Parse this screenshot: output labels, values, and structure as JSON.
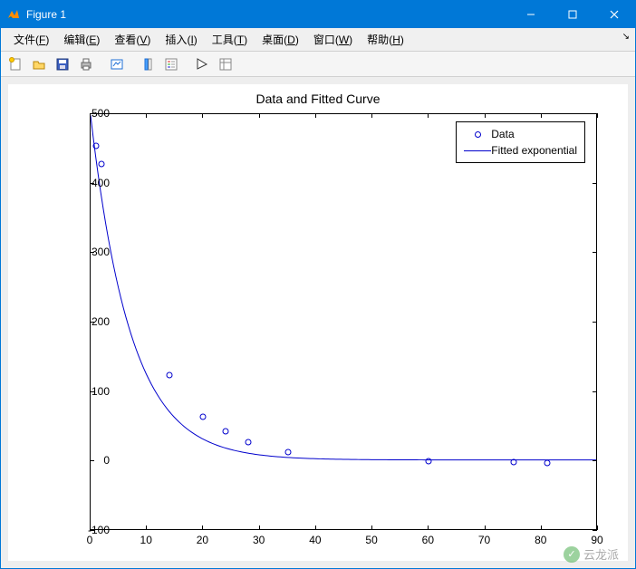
{
  "window": {
    "title": "Figure 1"
  },
  "menus": {
    "file": "文件",
    "file_u": "F",
    "edit": "编辑",
    "edit_u": "E",
    "view": "查看",
    "view_u": "V",
    "insert": "插入",
    "insert_u": "I",
    "tools": "工具",
    "tools_u": "T",
    "desktop": "桌面",
    "desktop_u": "D",
    "window_m": "窗口",
    "window_u": "W",
    "help": "帮助",
    "help_u": "H"
  },
  "legend": {
    "data": "Data",
    "fit": "Fitted exponential"
  },
  "watermark": {
    "text": "云龙派"
  },
  "chart_data": {
    "type": "scatter+line",
    "title": "Data and Fitted Curve",
    "xlabel": "",
    "ylabel": "",
    "xlim": [
      0,
      90
    ],
    "ylim": [
      -100,
      500
    ],
    "xticks": [
      0,
      10,
      20,
      30,
      40,
      50,
      60,
      70,
      80,
      90
    ],
    "yticks": [
      -100,
      0,
      100,
      200,
      300,
      400,
      500
    ],
    "series": [
      {
        "name": "Data",
        "type": "scatter",
        "x": [
          1,
          2,
          14,
          20,
          24,
          28,
          35,
          60,
          75,
          81
        ],
        "y": [
          455,
          428,
          125,
          65,
          43,
          28,
          14,
          1,
          -1,
          -2
        ]
      },
      {
        "name": "Fitted exponential",
        "type": "line",
        "formula": "y = 498 * exp(-0.14 * x)"
      }
    ]
  }
}
